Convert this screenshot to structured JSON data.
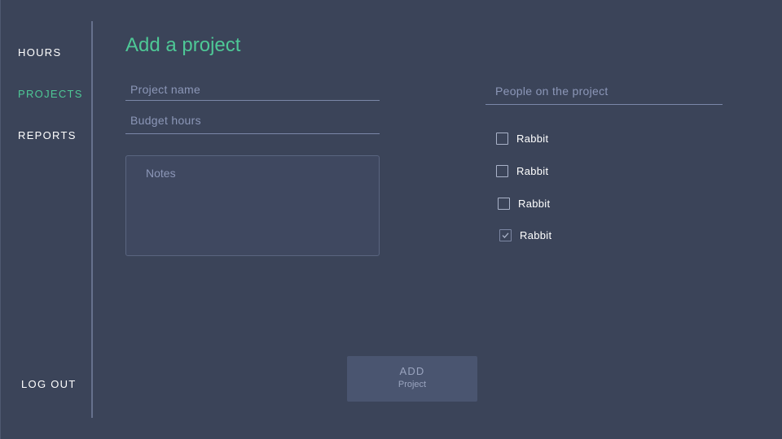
{
  "nav": {
    "hours": "HOURS",
    "projects": "PROJECTS",
    "reports": "REPORTS",
    "logout": "LOG OUT",
    "active": "projects"
  },
  "page": {
    "title": "Add a project"
  },
  "form": {
    "project_name": {
      "value": "",
      "placeholder": "Project name"
    },
    "budget_hours": {
      "value": "",
      "placeholder": "Budget hours"
    },
    "notes": {
      "value": "",
      "placeholder": "Notes"
    },
    "people": {
      "value": "",
      "placeholder": "People on the project"
    }
  },
  "people": [
    {
      "name": "Rabbit",
      "checked": false
    },
    {
      "name": "Rabbit",
      "checked": false
    },
    {
      "name": "Rabbit",
      "checked": false
    },
    {
      "name": "Rabbit",
      "checked": true
    }
  ],
  "add_button": {
    "label": "ADD",
    "sublabel": "Project"
  },
  "colors": {
    "background": "#3b4459",
    "accent": "#4ec896",
    "divider": "#66718d",
    "button_bg": "#4a5570"
  }
}
